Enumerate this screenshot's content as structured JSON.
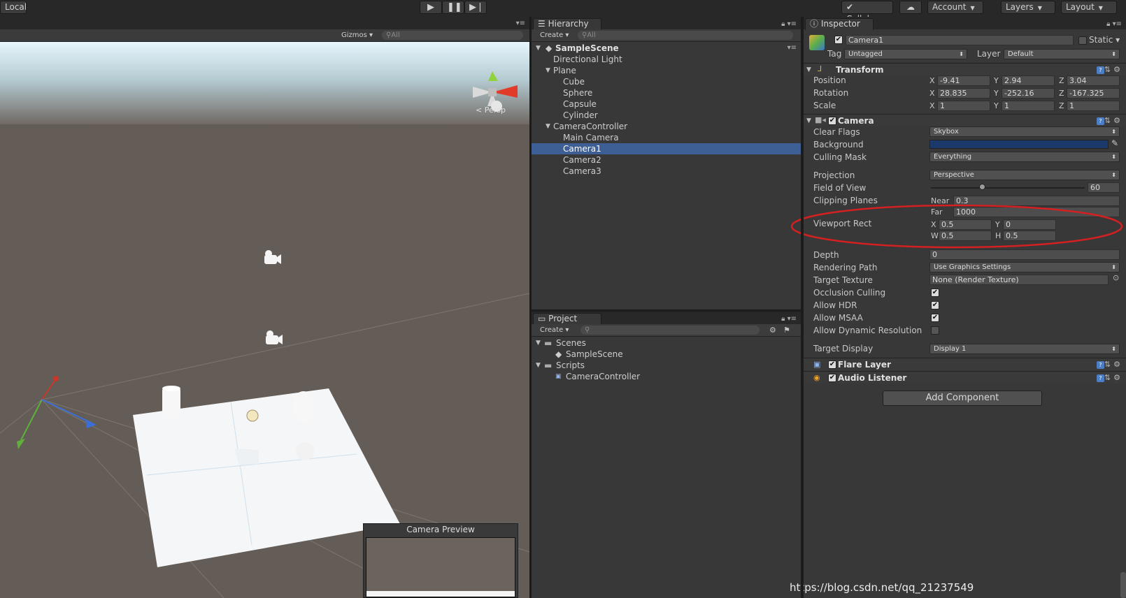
{
  "toolbar": {
    "local_label": "Local",
    "collab_label": "Collab",
    "account_label": "Account",
    "layers_label": "Layers",
    "layout_label": "Layout"
  },
  "scene": {
    "gizmos_label": "Gizmos",
    "search_placeholder": "All",
    "persp_label": "Persp",
    "camera_preview_title": "Camera Preview"
  },
  "hierarchy": {
    "tab_label": "Hierarchy",
    "create_label": "Create",
    "search_placeholder": "All",
    "scene_name": "SampleScene",
    "items": [
      {
        "label": "Directional Light"
      },
      {
        "label": "Plane"
      },
      {
        "label": "Cube"
      },
      {
        "label": "Sphere"
      },
      {
        "label": "Capsule"
      },
      {
        "label": "Cylinder"
      },
      {
        "label": "CameraController"
      },
      {
        "label": "Main Camera"
      },
      {
        "label": "Camera1"
      },
      {
        "label": "Camera2"
      },
      {
        "label": "Camera3"
      }
    ]
  },
  "project": {
    "tab_label": "Project",
    "create_label": "Create",
    "items": [
      {
        "label": "Scenes"
      },
      {
        "label": "SampleScene"
      },
      {
        "label": "Scripts"
      },
      {
        "label": "CameraController"
      }
    ]
  },
  "inspector": {
    "tab_label": "Inspector",
    "object_name": "Camera1",
    "static_label": "Static",
    "tag_label": "Tag",
    "tag_value": "Untagged",
    "layer_label": "Layer",
    "layer_value": "Default",
    "transform": {
      "title": "Transform",
      "position_label": "Position",
      "rotation_label": "Rotation",
      "scale_label": "Scale",
      "position": {
        "x": "-9.41",
        "y": "2.94",
        "z": "3.04"
      },
      "rotation": {
        "x": "28.835",
        "y": "-252.16",
        "z": "-167.325"
      },
      "scale": {
        "x": "1",
        "y": "1",
        "z": "1"
      }
    },
    "camera": {
      "title": "Camera",
      "clear_flags_label": "Clear Flags",
      "clear_flags_value": "Skybox",
      "background_label": "Background",
      "background_color": "#1b3a6b",
      "culling_mask_label": "Culling Mask",
      "culling_mask_value": "Everything",
      "projection_label": "Projection",
      "projection_value": "Perspective",
      "fov_label": "Field of View",
      "fov_value": "60",
      "clipping_label": "Clipping Planes",
      "near_label": "Near",
      "near_value": "0.3",
      "far_label": "Far",
      "far_value": "1000",
      "viewport_label": "Viewport Rect",
      "viewport": {
        "x": "0.5",
        "y": "0",
        "w": "0.5",
        "h": "0.5"
      },
      "depth_label": "Depth",
      "depth_value": "0",
      "rendering_path_label": "Rendering Path",
      "rendering_path_value": "Use Graphics Settings",
      "target_texture_label": "Target Texture",
      "target_texture_value": "None (Render Texture)",
      "occlusion_label": "Occlusion Culling",
      "hdr_label": "Allow HDR",
      "msaa_label": "Allow MSAA",
      "dynres_label": "Allow Dynamic Resolution",
      "target_display_label": "Target Display",
      "target_display_value": "Display 1"
    },
    "flare_layer_title": "Flare Layer",
    "audio_listener_title": "Audio Listener",
    "add_component_label": "Add Component"
  },
  "watermark": "https://blog.csdn.net/qq_21237549",
  "colors": {
    "selection": "#3e5f96",
    "highlight_ellipse": "#d42020"
  }
}
